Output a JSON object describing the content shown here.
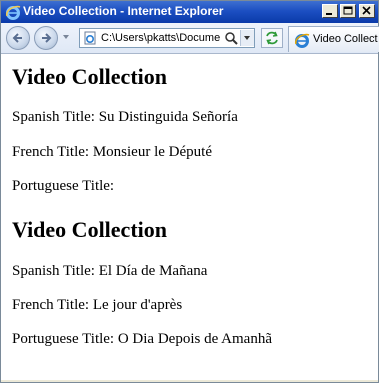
{
  "window": {
    "title": "Video Collection - Internet Explorer"
  },
  "navbar": {
    "address_value": "C:\\Users\\pkatts\\Docume",
    "tab_title": "Video Collect"
  },
  "content": {
    "sections": [
      {
        "heading": "Video Collection",
        "lines": [
          "Spanish Title: Su Distinguida Señoría",
          "French Title: Monsieur le Député",
          "Portuguese Title:"
        ]
      },
      {
        "heading": "Video Collection",
        "lines": [
          "Spanish Title: El Día de Mañana",
          "French Title: Le jour d'après",
          "Portuguese Title: O Dia Depois de Amanhã"
        ]
      }
    ]
  }
}
